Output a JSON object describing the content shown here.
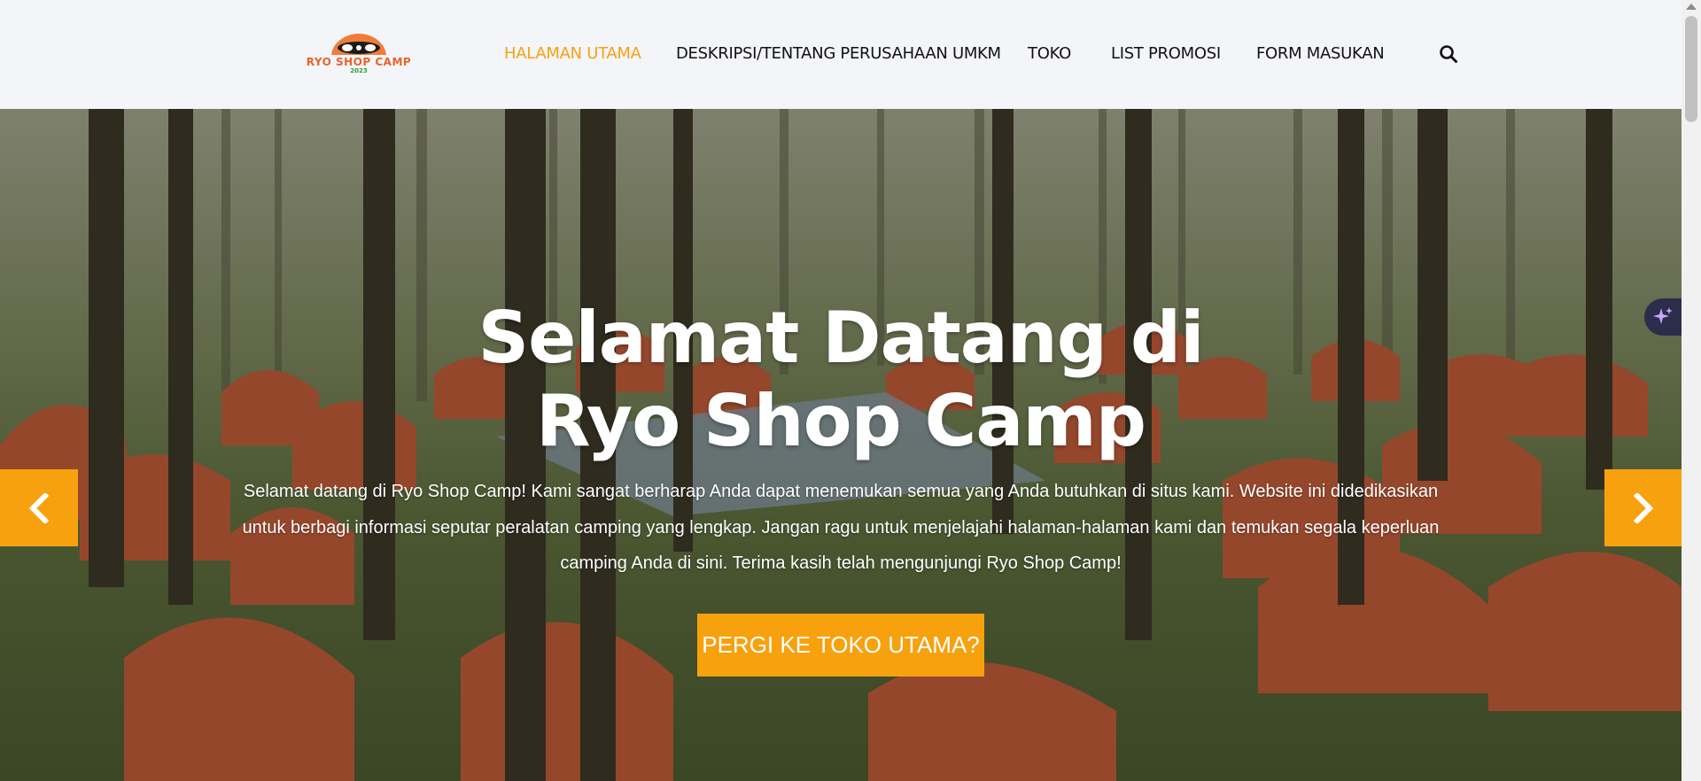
{
  "logo": {
    "name": "RYO SHOP CAMP",
    "year": "2023",
    "colors": {
      "tent": "#f07c3a",
      "text": "#e8632e",
      "year": "#2c9a3a"
    }
  },
  "nav": {
    "items": [
      {
        "label": "HALAMAN UTAMA",
        "active": true
      },
      {
        "label": "DESKRIPSI/TENTANG PERUSAHAAN UMKM",
        "active": false
      },
      {
        "label": "TOKO",
        "active": false
      },
      {
        "label": "LIST PROMOSI",
        "active": false
      },
      {
        "label": "FORM MASUKAN",
        "active": false
      }
    ],
    "search_icon": "search-icon"
  },
  "hero": {
    "title_line1": "Selamat Datang di",
    "title_line2": "Ryo Shop Camp",
    "text": "Selamat datang di Ryo Shop Camp! Kami sangat berharap Anda dapat menemukan semua yang Anda butuhkan di situs kami. Website ini didedikasikan untuk berbagi informasi seputar peralatan camping yang lengkap. Jangan ragu untuk menjelajahi halaman-halaman kami dan temukan segala keperluan camping Anda di sini. Terima kasih telah mengunjungi Ryo Shop Camp!",
    "cta_label": "PERGI KE TOKO UTAMA?",
    "prev_icon": "chevron-left-icon",
    "next_icon": "chevron-right-icon",
    "assistant_icon": "sparkle-icon",
    "background": "forest-campsite-tents-photo"
  },
  "colors": {
    "accent": "#f7a10f",
    "header_bg": "#f4f5f8",
    "nav_text": "#111111",
    "hero_text": "#ffffff"
  }
}
